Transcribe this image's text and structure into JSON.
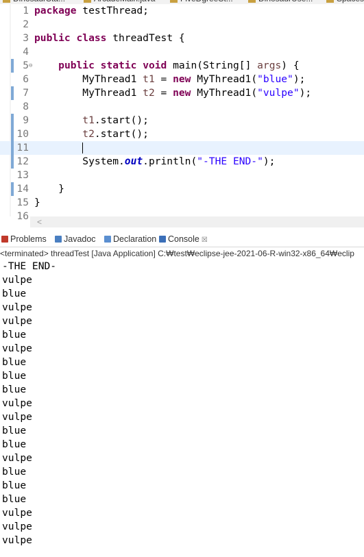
{
  "editor_tabs": [
    {
      "label": "DinosaurSta..."
    },
    {
      "label": "ArcadeMain.java"
    },
    {
      "label": "FiveDgreeSt..."
    },
    {
      "label": "DinosaurUse..."
    },
    {
      "label": "SpacesI"
    }
  ],
  "editor": {
    "lines": [
      {
        "num": "1",
        "segments": [
          {
            "t": "package",
            "c": "kw"
          },
          {
            "t": " testThread;",
            "c": ""
          }
        ]
      },
      {
        "num": "2",
        "segments": []
      },
      {
        "num": "3",
        "segments": [
          {
            "t": "public",
            "c": "kw"
          },
          {
            "t": " ",
            "c": ""
          },
          {
            "t": "class",
            "c": "kw"
          },
          {
            "t": " threadTest {",
            "c": ""
          }
        ]
      },
      {
        "num": "4",
        "segments": []
      },
      {
        "num": "5",
        "fold": true,
        "segments": [
          {
            "t": "    ",
            "c": ""
          },
          {
            "t": "public",
            "c": "kw"
          },
          {
            "t": " ",
            "c": ""
          },
          {
            "t": "static",
            "c": "kw"
          },
          {
            "t": " ",
            "c": ""
          },
          {
            "t": "void",
            "c": "kw"
          },
          {
            "t": " main(String[] ",
            "c": ""
          },
          {
            "t": "args",
            "c": "var"
          },
          {
            "t": ") {",
            "c": ""
          }
        ]
      },
      {
        "num": "6",
        "segments": [
          {
            "t": "        MyThread1 ",
            "c": ""
          },
          {
            "t": "t1",
            "c": "var"
          },
          {
            "t": " = ",
            "c": ""
          },
          {
            "t": "new",
            "c": "kw"
          },
          {
            "t": " MyThread1(",
            "c": ""
          },
          {
            "t": "\"blue\"",
            "c": "str"
          },
          {
            "t": ");",
            "c": ""
          }
        ]
      },
      {
        "num": "7",
        "segments": [
          {
            "t": "        MyThread1 ",
            "c": ""
          },
          {
            "t": "t2",
            "c": "var"
          },
          {
            "t": " = ",
            "c": ""
          },
          {
            "t": "new",
            "c": "kw"
          },
          {
            "t": " MyThread1(",
            "c": ""
          },
          {
            "t": "\"vulpe\"",
            "c": "str"
          },
          {
            "t": ");",
            "c": ""
          }
        ]
      },
      {
        "num": "8",
        "segments": []
      },
      {
        "num": "9",
        "segments": [
          {
            "t": "        ",
            "c": ""
          },
          {
            "t": "t1",
            "c": "var"
          },
          {
            "t": ".start();",
            "c": ""
          }
        ]
      },
      {
        "num": "10",
        "segments": [
          {
            "t": "        ",
            "c": ""
          },
          {
            "t": "t2",
            "c": "var"
          },
          {
            "t": ".start();",
            "c": ""
          }
        ]
      },
      {
        "num": "11",
        "current": true,
        "segments": []
      },
      {
        "num": "12",
        "segments": [
          {
            "t": "        System.",
            "c": ""
          },
          {
            "t": "out",
            "c": "field"
          },
          {
            "t": ".println(",
            "c": ""
          },
          {
            "t": "\"-THE END-\"",
            "c": "str"
          },
          {
            "t": ");",
            "c": ""
          }
        ]
      },
      {
        "num": "13",
        "segments": []
      },
      {
        "num": "14",
        "segments": [
          {
            "t": "    }",
            "c": ""
          }
        ]
      },
      {
        "num": "15",
        "segments": [
          {
            "t": "}",
            "c": ""
          }
        ]
      },
      {
        "num": "16",
        "segments": []
      }
    ]
  },
  "hscroll": {
    "left_arrow": "<"
  },
  "view_tabs": [
    {
      "label": "Problems",
      "icon": "problems-icon",
      "color": "#c0392b"
    },
    {
      "label": "Javadoc",
      "icon": "javadoc-icon",
      "color": "#4a7fc1"
    },
    {
      "label": "Declaration",
      "icon": "declaration-icon",
      "color": "#5b8fd0"
    },
    {
      "label": "Console",
      "icon": "console-icon",
      "color": "#3b6fb8",
      "active": true,
      "close": "☒"
    }
  ],
  "console": {
    "status": "<terminated> threadTest [Java Application] C:₩test₩eclipse-jee-2021-06-R-win32-x86_64₩eclip",
    "output": [
      "-THE END-",
      "vulpe",
      "blue",
      "vulpe",
      "vulpe",
      "blue",
      "vulpe",
      "blue",
      "blue",
      "blue",
      "vulpe",
      "vulpe",
      "blue",
      "blue",
      "vulpe",
      "blue",
      "blue",
      "blue",
      "vulpe",
      "vulpe",
      "vulpe"
    ]
  }
}
